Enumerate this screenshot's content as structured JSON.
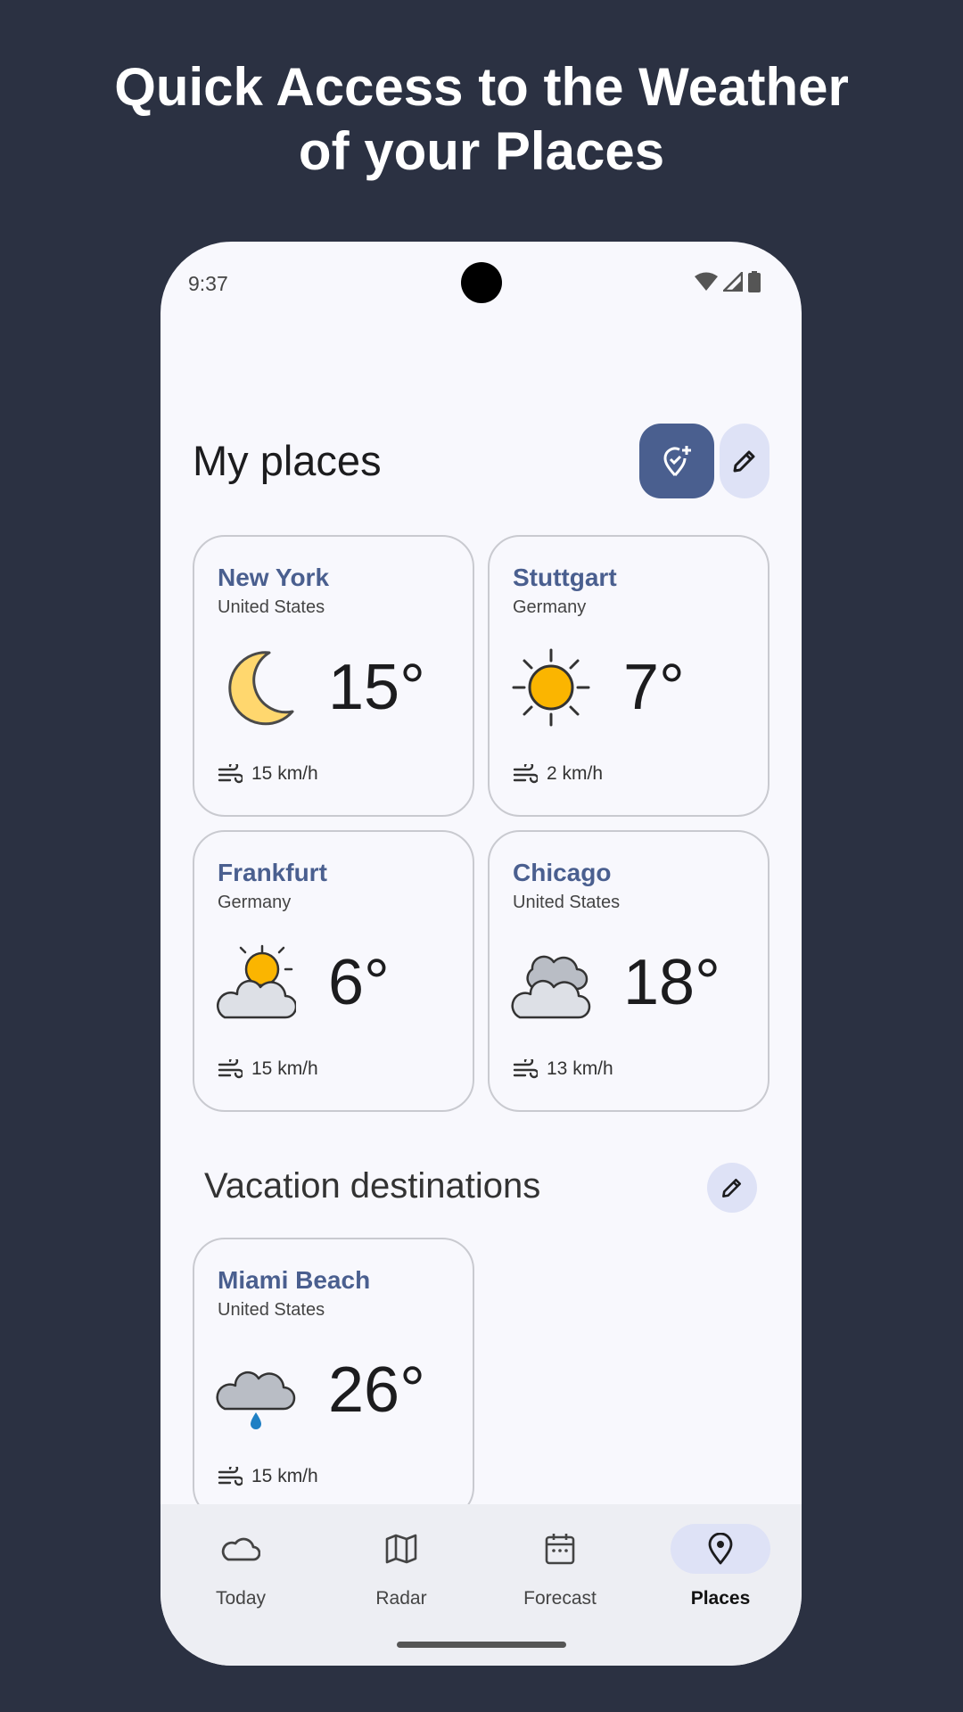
{
  "headline": {
    "line1": "Quick Access to the Weather",
    "line2": "of your Places"
  },
  "status_bar": {
    "time": "9:37"
  },
  "my_places": {
    "title": "My places",
    "cards": [
      {
        "city": "New York",
        "country": "United States",
        "temp": "15°",
        "wind": "15 km/h",
        "icon": "moon-icon"
      },
      {
        "city": "Stuttgart",
        "country": "Germany",
        "temp": "7°",
        "wind": "2 km/h",
        "icon": "sun-icon"
      },
      {
        "city": "Frankfurt",
        "country": "Germany",
        "temp": "6°",
        "wind": "15 km/h",
        "icon": "partly-cloudy-icon"
      },
      {
        "city": "Chicago",
        "country": "United States",
        "temp": "18°",
        "wind": "13 km/h",
        "icon": "cloudy-icon"
      }
    ]
  },
  "vacation": {
    "title": "Vacation destinations",
    "cards": [
      {
        "city": "Miami Beach",
        "country": "United States",
        "temp": "26°",
        "wind": "15 km/h",
        "icon": "rain-cloud-icon"
      }
    ]
  },
  "nav": {
    "items": [
      {
        "label": "Today",
        "icon": "cloud-icon"
      },
      {
        "label": "Radar",
        "icon": "map-icon"
      },
      {
        "label": "Forecast",
        "icon": "calendar-icon"
      },
      {
        "label": "Places",
        "icon": "location-pin-icon"
      }
    ],
    "active": "Places"
  },
  "colors": {
    "background": "#2b3142",
    "accent": "#4a5f8f",
    "accent_light": "#dee2f6",
    "sun": "#fbb500",
    "moon": "#ffd76e"
  }
}
